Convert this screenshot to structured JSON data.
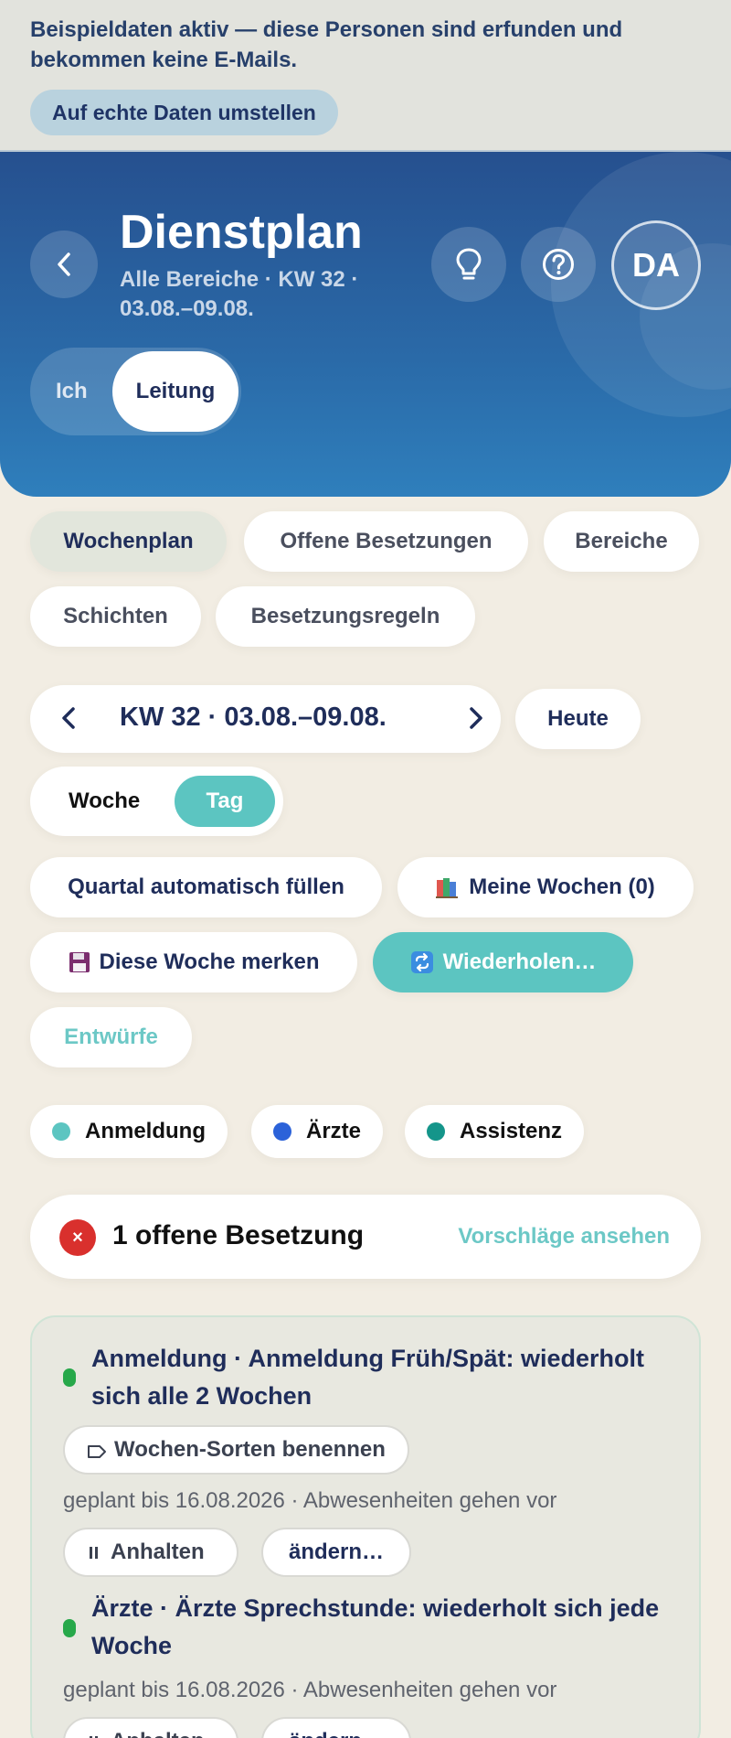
{
  "banner": {
    "text": "Beispieldaten aktiv — diese Personen sind erfunden und bekommen keine E-Mails.",
    "button_label": "Auf echte Daten umstellen"
  },
  "header": {
    "title": "Dienstplan",
    "subtitle": "Alle Bereiche · KW 32 · 03.08.–09.08.",
    "avatar_initials": "DA",
    "role_toggle": {
      "option_1": "Ich",
      "option_2": "Leitung",
      "selected": "Leitung"
    }
  },
  "tabs": [
    {
      "label": "Wochenplan",
      "active": true
    },
    {
      "label": "Offene Besetzungen",
      "active": false
    },
    {
      "label": "Bereiche",
      "active": false
    },
    {
      "label": "Schichten",
      "active": false
    },
    {
      "label": "Besetzungsregeln",
      "active": false
    }
  ],
  "week_nav": {
    "label": "KW 32 · 03.08.–09.08.",
    "today_label": "Heute"
  },
  "view_toggle": {
    "week_label": "Woche",
    "day_label": "Tag",
    "selected": "Tag"
  },
  "actions": {
    "autofill_label": "Quartal automatisch füllen",
    "my_weeks_label": "Meine Wochen (0)",
    "save_week_label": "Diese Woche merken",
    "repeat_label": "Wiederholen…",
    "drafts_label": "Entwürfe"
  },
  "legend": [
    {
      "label": "Anmeldung",
      "color": "#5cc5c1"
    },
    {
      "label": "Ärzte",
      "color": "#2b62d9"
    },
    {
      "label": "Assistenz",
      "color": "#14958a"
    }
  ],
  "open_shifts": {
    "text": "1 offene Besetzung",
    "link_label": "Vorschläge ansehen",
    "status_color": "#d9302d"
  },
  "rules": [
    {
      "title": "Anmeldung · Anmeldung Früh/Spät: wiederholt sich alle 2 Wochen",
      "tag_label": "Wochen-Sorten benennen",
      "meta": "geplant bis 16.08.2026 · Abwesenheiten gehen vor",
      "pause_label": "Anhalten",
      "edit_label": "ändern…"
    },
    {
      "title": "Ärzte · Ärzte Sprechstunde: wiederholt sich jede Woche",
      "meta": "geplant bis 16.08.2026 · Abwesenheiten gehen vor",
      "pause_label": "Anhalten",
      "edit_label": "ändern…"
    }
  ],
  "colors": {
    "accent_teal": "#5cc5c1",
    "header_blue": "#2a6aa8",
    "status_green": "#27a84a"
  }
}
